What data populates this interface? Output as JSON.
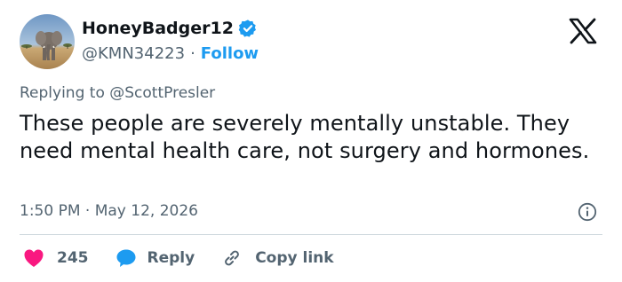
{
  "user": {
    "display_name": "HoneyBadger12",
    "handle": "@KMN34223",
    "separator": "·",
    "follow_label": "Follow",
    "verified": true
  },
  "tweet": {
    "replying_prefix": "Replying to ",
    "replying_to": "@ScottPresler",
    "text": "These people are severely mentally unstable. They need mental health care, not surgery and hormones.",
    "timestamp": "1:50 PM · May 12, 2026"
  },
  "actions": {
    "like_count": "245",
    "reply_label": "Reply",
    "copy_link_label": "Copy link"
  },
  "colors": {
    "accent": "#1d9bf0",
    "like": "#f91880",
    "secondary_text": "#536471",
    "divider": "#cfd9de"
  },
  "icons": [
    "verified-badge-icon",
    "x-logo-icon",
    "info-icon",
    "heart-icon",
    "reply-bubble-icon",
    "link-icon"
  ]
}
